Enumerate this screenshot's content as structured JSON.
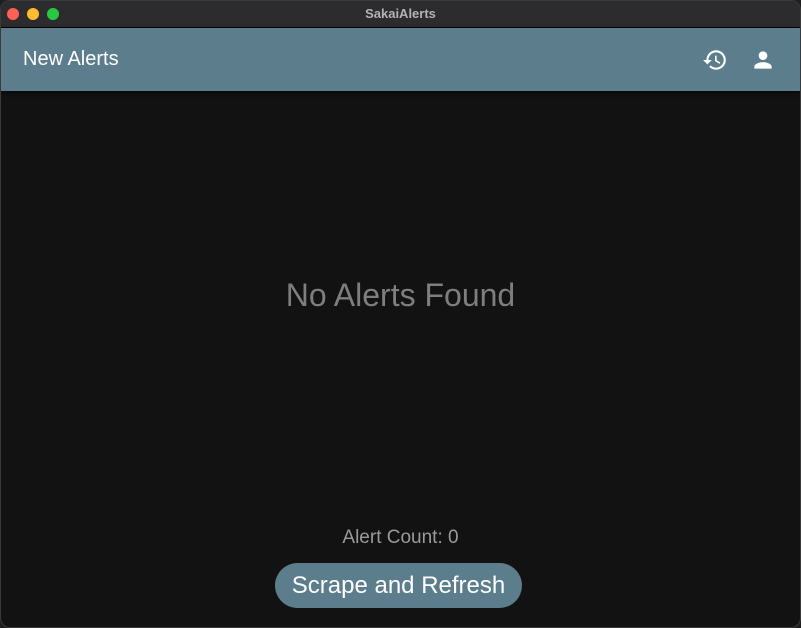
{
  "window": {
    "title": "SakaiAlerts"
  },
  "appbar": {
    "title": "New Alerts",
    "actions": [
      {
        "icon": "history-icon"
      },
      {
        "icon": "person-icon"
      }
    ]
  },
  "main": {
    "empty_message": "No Alerts Found",
    "alert_count": "Alert Count: 0",
    "refresh_label": "Scrape and Refresh"
  },
  "colors": {
    "accent": "#5c7d8c",
    "background": "#121212",
    "titlebar": "#2c2c2e"
  }
}
